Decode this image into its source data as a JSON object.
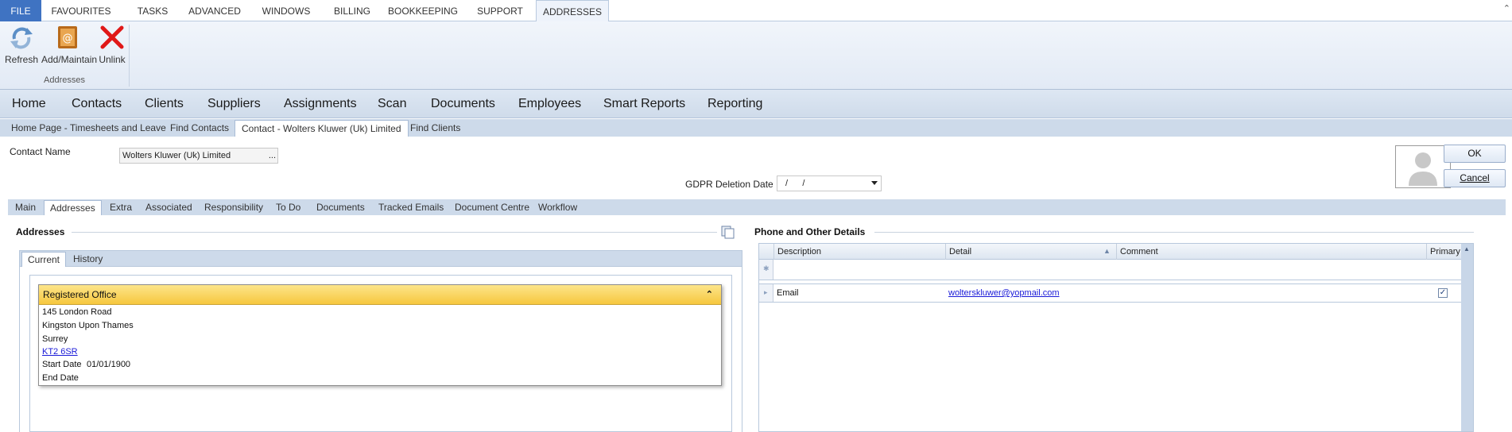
{
  "ribbon": {
    "tabs": [
      "FILE",
      "FAVOURITES",
      "TASKS",
      "ADVANCED",
      "WINDOWS",
      "BILLING",
      "BOOKKEEPING",
      "SUPPORT",
      "ADDRESSES"
    ],
    "active_tab": "ADDRESSES",
    "buttons": {
      "refresh": "Refresh",
      "add_maintain": "Add/Maintain",
      "unlink": "Unlink"
    },
    "group_label": "Addresses"
  },
  "main_nav": [
    "Home",
    "Contacts",
    "Clients",
    "Suppliers",
    "Assignments",
    "Scan",
    "Documents",
    "Employees",
    "Smart Reports",
    "Reporting"
  ],
  "doc_tabs": [
    "Home Page - Timesheets and Leave",
    "Find Contacts",
    "Contact - Wolters Kluwer (Uk) Limited",
    "Find Clients"
  ],
  "form": {
    "contact_name_label": "Contact Name",
    "contact_name_value": "Wolters Kluwer (Uk) Limited",
    "contact_name_button": "...",
    "gdpr_label": "GDPR Deletion Date",
    "gdpr_value": "/      /",
    "ok_label": "OK",
    "cancel_label": "Cancel"
  },
  "form_tabs": [
    "Main",
    "Addresses",
    "Extra",
    "Associated",
    "Responsibility",
    "To Do",
    "Documents",
    "Tracked Emails",
    "Document Centre",
    "Workflow"
  ],
  "addresses": {
    "title": "Addresses",
    "tabs": [
      "Current",
      "History"
    ],
    "card": {
      "title": "Registered Office",
      "line1": "145 London Road",
      "line2": "Kingston Upon Thames",
      "line3": "Surrey",
      "postcode": "KT2 6SR",
      "start_label": "Start Date",
      "start_value": "01/01/1900",
      "end_label": "End Date"
    }
  },
  "phone": {
    "title": "Phone and Other Details",
    "columns": [
      "Description",
      "Detail",
      "Comment",
      "Primary"
    ],
    "rows": [
      {
        "description": "Email",
        "detail": "wolterskluwer@yopmail.com",
        "comment": "",
        "primary": true
      }
    ]
  },
  "colors": {
    "file_tab": "#3f73c2",
    "card_header": "#f6c73e",
    "link": "#1a1ad8"
  }
}
